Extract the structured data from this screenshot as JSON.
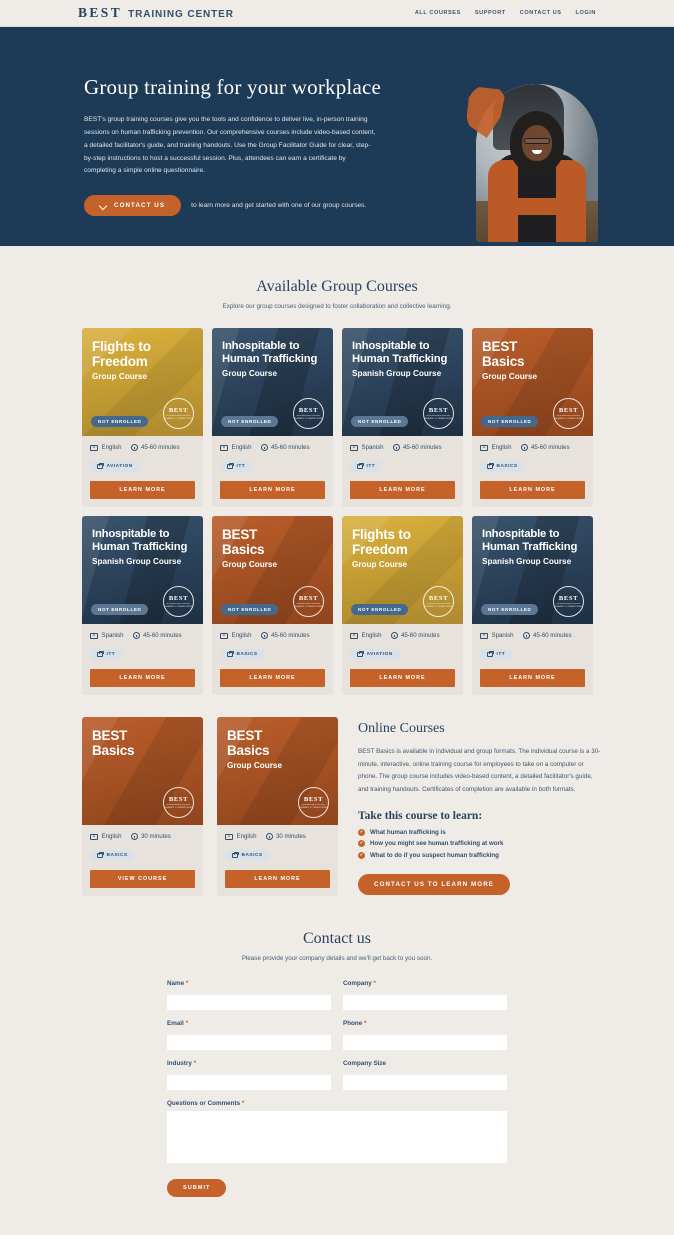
{
  "header": {
    "logo_best": "BEST",
    "logo_sub": "TRAINING CENTER",
    "nav": [
      {
        "label": "ALL COURSES"
      },
      {
        "label": "SUPPORT"
      },
      {
        "label": "CONTACT US"
      },
      {
        "label": "LOGIN"
      }
    ]
  },
  "hero": {
    "title": "Group training for your workplace",
    "body": "BEST's group training courses give you the tools and confidence to deliver live, in-person training sessions on human trafficking prevention. Our comprehensive courses include video-based content, a detailed facilitator's guide, and training handouts. Use the Group Facilitator Guide for clear, step-by-step instructions to host a successful session. Plus, attendees can earn a certificate by completing a simple online questionnaire.",
    "cta_label": "CONTACT US",
    "cta_note": "to learn more and get started with one of our group courses.",
    "bg_color": "#1d3a56"
  },
  "courses_section": {
    "title": "Available Group Courses",
    "subtitle": "Explore our group courses designed to foster collaboration and collective learning."
  },
  "seal": {
    "top": "BEST",
    "bottom": "BUSINESSES ENDING\nSLAVERY & TRAFFICKING"
  },
  "courses": [
    {
      "title": "Flights to\nFreedom",
      "subtitle": "Group Course",
      "theme": "yellow",
      "big": true,
      "badge": "NOT ENROLLED",
      "language": "English",
      "duration": "45-60 minutes",
      "tag": "AVIATION",
      "button": "LEARN MORE"
    },
    {
      "title": "Inhospitable to\nHuman Trafficking",
      "subtitle": "Group Course",
      "theme": "navy",
      "big": false,
      "badge": "NOT ENROLLED",
      "language": "English",
      "duration": "45-60 minutes",
      "tag": "ITT",
      "button": "LEARN MORE"
    },
    {
      "title": "Inhospitable to\nHuman Trafficking",
      "subtitle": "Spanish Group Course",
      "theme": "navy",
      "big": false,
      "badge": "NOT ENROLLED",
      "language": "Spanish",
      "duration": "45-60 minutes",
      "tag": "ITT",
      "button": "LEARN MORE"
    },
    {
      "title": "BEST\nBasics",
      "subtitle": "Group Course",
      "theme": "orange",
      "big": true,
      "badge": "NOT ENROLLED",
      "language": "English",
      "duration": "45-60 minutes",
      "tag": "BASICS",
      "button": "LEARN MORE"
    },
    {
      "title": "Inhospitable to\nHuman Trafficking",
      "subtitle": "Spanish Group Course",
      "theme": "navy",
      "big": false,
      "badge": "NOT ENROLLED",
      "language": "Spanish",
      "duration": "45-60 minutes",
      "tag": "ITT",
      "button": "LEARN MORE"
    },
    {
      "title": "BEST\nBasics",
      "subtitle": "Group Course",
      "theme": "orange",
      "big": true,
      "badge": "NOT ENROLLED",
      "language": "English",
      "duration": "45-60 minutes",
      "tag": "BASICS",
      "button": "LEARN MORE"
    },
    {
      "title": "Flights to\nFreedom",
      "subtitle": "Group Course",
      "theme": "yellow",
      "big": true,
      "badge": "NOT ENROLLED",
      "language": "English",
      "duration": "45-60 minutes",
      "tag": "AVIATION",
      "button": "LEARN MORE"
    },
    {
      "title": "Inhospitable to\nHuman Trafficking",
      "subtitle": "Spanish Group Course",
      "theme": "navy",
      "big": false,
      "badge": "NOT ENROLLED",
      "language": "Spanish",
      "duration": "45-60 minutes",
      "tag": "ITT",
      "button": "LEARN MORE"
    },
    {
      "title": "BEST\nBasics",
      "subtitle": "",
      "theme": "orange",
      "big": true,
      "badge": "",
      "language": "English",
      "duration": "30 minutes",
      "tag": "BASICS",
      "button": "VIEW COURSE"
    },
    {
      "title": "BEST\nBasics",
      "subtitle": "Group Course",
      "theme": "orange",
      "big": true,
      "badge": "",
      "language": "English",
      "duration": "30 minutes",
      "tag": "BASICS",
      "button": "LEARN MORE"
    }
  ],
  "online": {
    "title": "Online Courses",
    "body": "BEST Basics is available in individual and group formats. The individual course is a 30-minute, interactive, online training course for employees to take on a computer or phone. The group course includes video-based content, a detailed facilitator's guide, and training handouts. Certificates of completion are available in both formats.",
    "learn_title": "Take this course to learn:",
    "learn_items": [
      "What human trafficking is",
      "How you might see human trafficking at work",
      "What to do if you suspect human trafficking"
    ],
    "cta_label": "CONTACT US TO LEARN MORE"
  },
  "contact": {
    "title": "Contact us",
    "subtitle": "Please provide your company details and we'll get back to you soon.",
    "fields": {
      "name": {
        "label": "Name",
        "required": "*",
        "value": ""
      },
      "company": {
        "label": "Company",
        "required": "*",
        "value": ""
      },
      "email": {
        "label": "Email",
        "required": "*",
        "value": ""
      },
      "phone": {
        "label": "Phone",
        "required": "*",
        "value": ""
      },
      "industry": {
        "label": "Industry",
        "required": "*",
        "value": ""
      },
      "company_size": {
        "label": "Company Size",
        "required": "",
        "value": ""
      },
      "questions": {
        "label": "Questions or Comments",
        "required": "*",
        "value": ""
      }
    },
    "submit_label": "SUBMIT"
  },
  "colors": {
    "navy": "#1d3a56",
    "orange": "#c4622a",
    "cream": "#efebe6",
    "gold": "#d9ad38"
  }
}
